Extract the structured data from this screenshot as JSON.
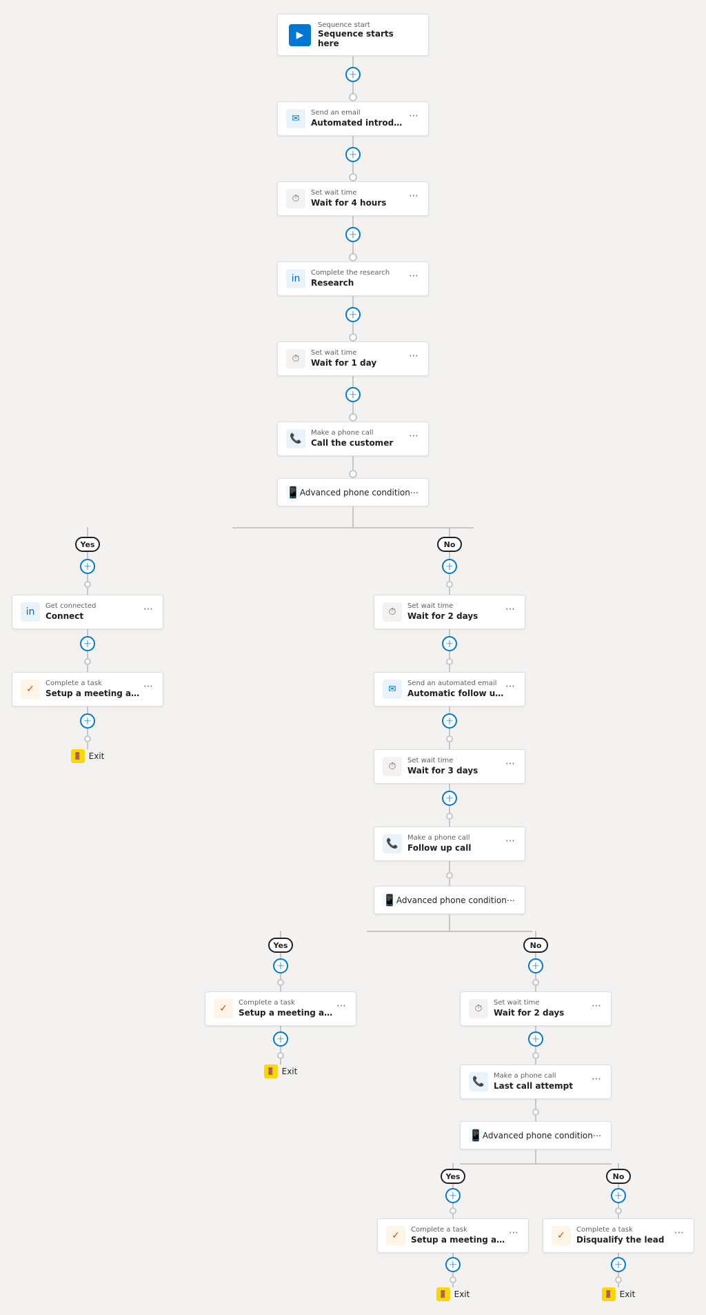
{
  "nodes": {
    "start": {
      "label": "Sequence start",
      "title": "Sequence starts here"
    },
    "email1": {
      "label": "Send an email",
      "title": "Automated introductory email"
    },
    "wait1": {
      "label": "Set wait time",
      "title": "Wait for 4 hours"
    },
    "research": {
      "label": "Complete the research",
      "title": "Research"
    },
    "wait2": {
      "label": "Set wait time",
      "title": "Wait for 1 day"
    },
    "call1": {
      "label": "Make a phone call",
      "title": "Call the customer"
    },
    "condition1": {
      "label": "",
      "title": "Advanced phone condition"
    },
    "yes_label": "Yes",
    "no_label": "No",
    "connect": {
      "label": "Get connected",
      "title": "Connect"
    },
    "task1": {
      "label": "Complete a task",
      "title": "Setup a meeting and move to the next s..."
    },
    "exit1": "Exit",
    "wait3": {
      "label": "Set wait time",
      "title": "Wait for 2 days"
    },
    "email2": {
      "label": "Send an automated email",
      "title": "Automatic follow up email"
    },
    "wait4": {
      "label": "Set wait time",
      "title": "Wait for 3 days"
    },
    "call2": {
      "label": "Make a phone call",
      "title": "Follow up call"
    },
    "condition2": {
      "label": "",
      "title": "Advanced phone condition"
    },
    "yes2_label": "Yes",
    "no2_label": "No",
    "task2": {
      "label": "Complete a task",
      "title": "Setup a meeting and move to the next s..."
    },
    "exit2": "Exit",
    "wait5": {
      "label": "Set wait time",
      "title": "Wait for 2 days"
    },
    "call3": {
      "label": "Make a phone call",
      "title": "Last call attempt"
    },
    "condition3": {
      "label": "",
      "title": "Advanced phone condition"
    },
    "yes3_label": "Yes",
    "no3_label": "No",
    "task3": {
      "label": "Complete a task",
      "title": "Setup a meeting and move to the next s..."
    },
    "task4": {
      "label": "Complete a task",
      "title": "Disqualify the lead"
    },
    "exit3": "Exit",
    "exit4": "Exit"
  },
  "colors": {
    "blue": "#0078d4",
    "line": "#c8c6c4",
    "bg": "#f3f2f1",
    "border": "#e1dfdd"
  }
}
